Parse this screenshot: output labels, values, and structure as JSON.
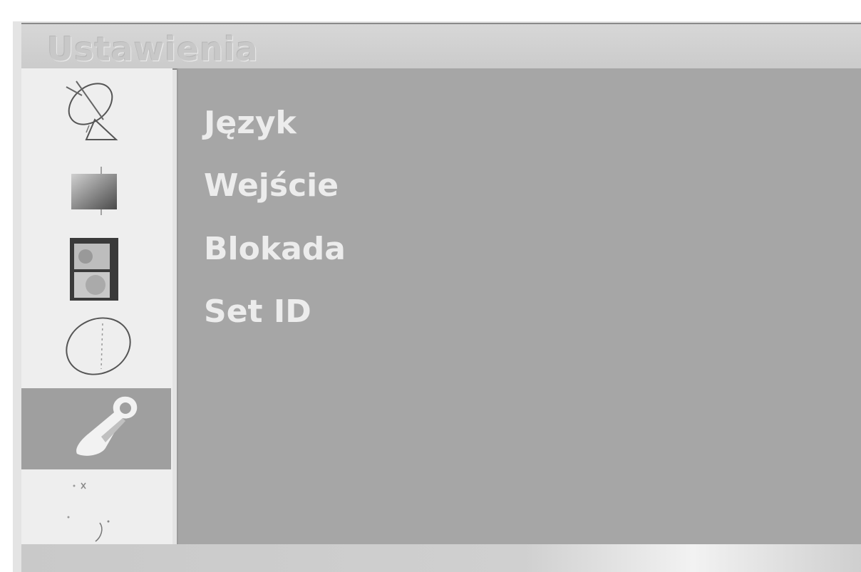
{
  "header": {
    "title": "Ustawienia"
  },
  "sidebar": {
    "items": [
      {
        "icon": "satellite-dish-icon",
        "selected": false
      },
      {
        "icon": "picture-gradient-icon",
        "selected": false
      },
      {
        "icon": "speaker-icon",
        "selected": false
      },
      {
        "icon": "clock-icon",
        "selected": false
      },
      {
        "icon": "wrench-icon",
        "selected": true
      },
      {
        "icon": "star-icon",
        "selected": false
      },
      {
        "icon": "arrow-icon",
        "selected": false
      }
    ]
  },
  "main": {
    "items": [
      {
        "label": "Język"
      },
      {
        "label": "Wejście"
      },
      {
        "label": "Blokada"
      },
      {
        "label": "Set ID"
      }
    ]
  },
  "colors": {
    "panel": "#a6a6a6",
    "sidebar": "#eeeeee",
    "selected": "#9f9f9f",
    "text": "#ececec"
  }
}
